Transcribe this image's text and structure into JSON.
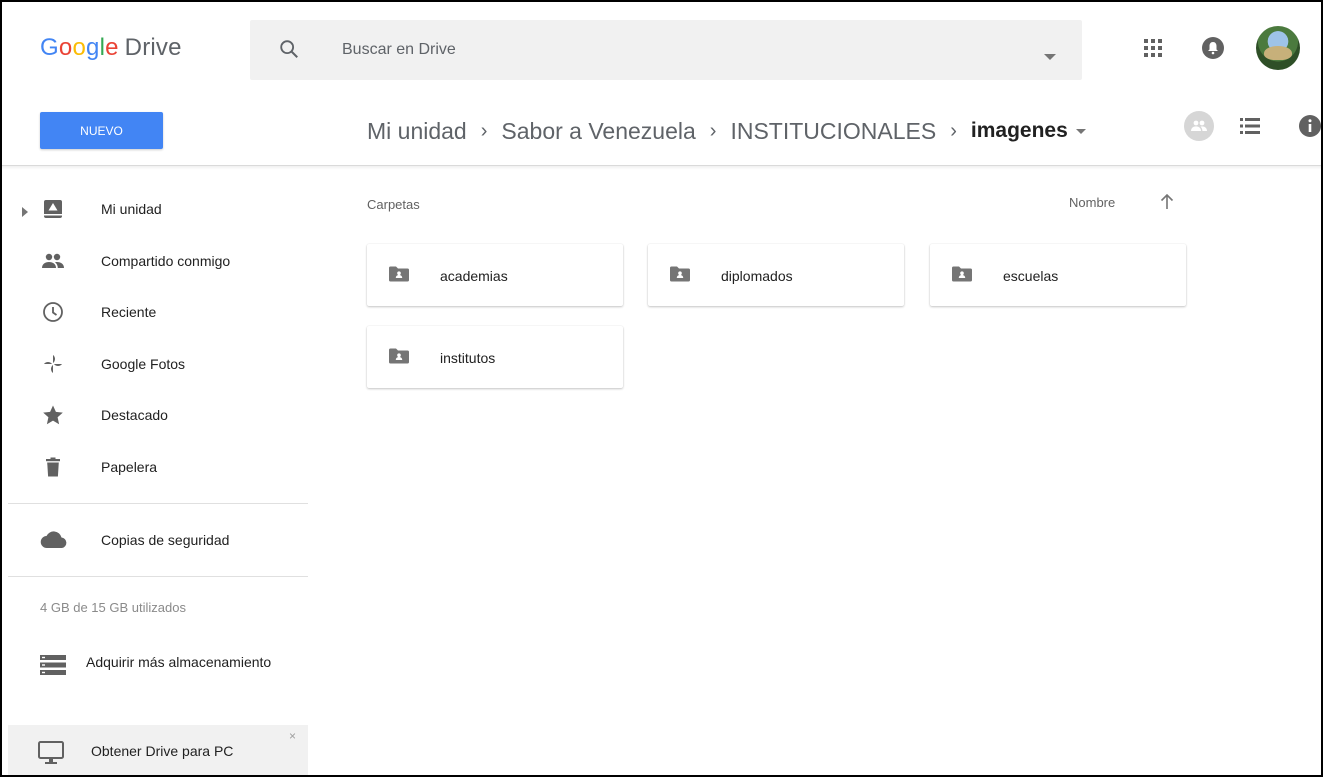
{
  "header": {
    "logo_google": "Google",
    "logo_product": "Drive",
    "search_placeholder": "Buscar en Drive",
    "icons": [
      "search-icon",
      "dropdown-arrow-icon",
      "apps-icon",
      "notifications-icon",
      "avatar"
    ]
  },
  "toolbar": {
    "new_button": "NUEVO",
    "breadcrumb": [
      "Mi unidad",
      "Sabor a Venezuela",
      "INSTITUCIONALES",
      "imagenes"
    ],
    "icons": [
      "shared-icon",
      "list-view-icon",
      "info-icon"
    ]
  },
  "sidebar": {
    "items": [
      {
        "label": "Mi unidad",
        "icon": "my-drive-icon"
      },
      {
        "label": "Compartido conmigo",
        "icon": "shared-with-me-icon"
      },
      {
        "label": "Reciente",
        "icon": "clock-icon"
      },
      {
        "label": "Google Fotos",
        "icon": "photos-pinwheel-icon"
      },
      {
        "label": "Destacado",
        "icon": "star-icon"
      },
      {
        "label": "Papelera",
        "icon": "trash-icon"
      }
    ],
    "backups": {
      "label": "Copias de seguridad",
      "icon": "cloud-icon"
    },
    "storage_text": "4 GB de 15 GB utilizados",
    "buy_storage": "Adquirir más almacenamiento",
    "get_drive": "Obtener Drive para PC",
    "close_symbol": "×"
  },
  "main": {
    "section_title": "Carpetas",
    "sort_label": "Nombre",
    "folders": [
      {
        "name": "academias"
      },
      {
        "name": "diplomados"
      },
      {
        "name": "escuelas"
      },
      {
        "name": "institutos"
      }
    ]
  },
  "colors": {
    "accent": "#4285f4",
    "icon_gray": "#616161",
    "search_bg": "#f1f1f1"
  }
}
